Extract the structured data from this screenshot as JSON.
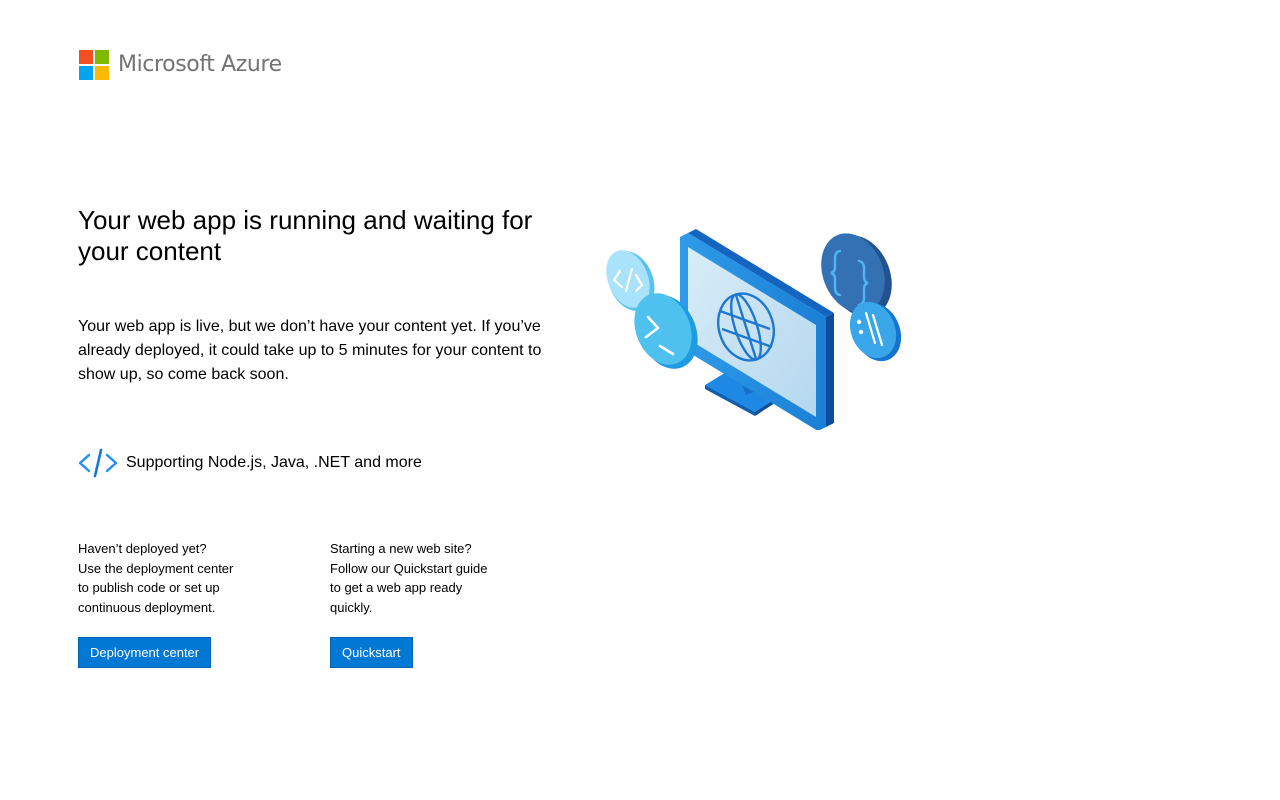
{
  "brand": {
    "name": "Microsoft Azure",
    "colors": {
      "red": "#f25022",
      "green": "#7fba00",
      "blue": "#00a4ef",
      "yellow": "#ffb900",
      "text": "#737373"
    }
  },
  "main": {
    "heading": "Your web app is running and waiting for your content",
    "description": "Your web app is live, but we don’t have your content yet. If you’ve already deployed, it could take up to 5 minutes for your content to show up, so come back soon.",
    "supporting": {
      "icon": "code-icon",
      "text": "Supporting Node.js, Java, .NET and more"
    },
    "illustration_icon": "monitor-globe-illustration"
  },
  "columns": [
    {
      "lines": [
        "Haven’t deployed yet?",
        "Use the deployment center",
        "to publish code or set up",
        "continuous deployment."
      ],
      "button_label": "Deployment center"
    },
    {
      "lines": [
        "Starting a new web site?",
        "Follow our Quickstart guide",
        "to get a web app ready",
        "quickly."
      ],
      "button_label": "Quickstart"
    }
  ],
  "accent_color": "#0078d4"
}
